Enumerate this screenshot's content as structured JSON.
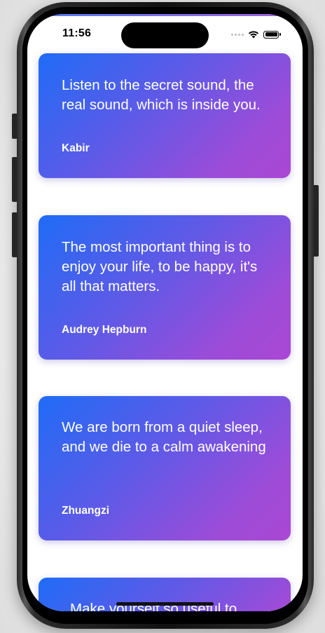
{
  "status_bar": {
    "time": "11:56"
  },
  "quotes": [
    {
      "text": "Listen to the secret sound, the real sound, which is inside you.",
      "author": "Kabir"
    },
    {
      "text": "The most important thing is to enjoy your life, to be happy, it's all that matters.",
      "author": "Audrey Hepburn"
    },
    {
      "text": "We are born from a quiet sleep, and we die to a calm awakening",
      "author": "Zhuangzi"
    },
    {
      "text": "Make yourself so useful to",
      "author": ""
    }
  ],
  "colors": {
    "card_gradient_start": "#1f6cf6",
    "card_gradient_end": "#aa47d3",
    "screen_background": "#ffffff"
  },
  "icons": [
    "cellular-signal-icon",
    "wifi-icon",
    "battery-icon"
  ]
}
